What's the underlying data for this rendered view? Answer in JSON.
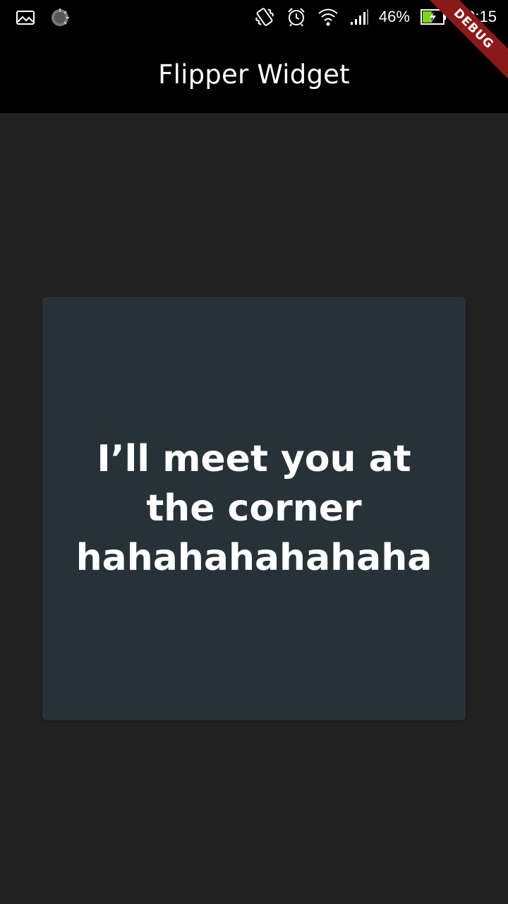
{
  "status_bar": {
    "left_icons": [
      "image-notification-icon",
      "loading-spinner-icon"
    ],
    "right_icons": [
      "vibrate-icon",
      "alarm-icon",
      "wifi-icon",
      "signal-icon",
      "battery-charging-icon"
    ],
    "battery_percent": "46%",
    "battery_level": 0.46,
    "time": "10:15"
  },
  "app_bar": {
    "title": "Flipper Widget"
  },
  "debug_banner": {
    "label": "DEBUG",
    "color": "#8a1a1a"
  },
  "card": {
    "text": "I’ll meet you at the corner hahahahahahaha",
    "background": "#263238"
  },
  "colors": {
    "background": "#212121",
    "app_bar": "#000000",
    "battery_fill": "#7ed321"
  }
}
